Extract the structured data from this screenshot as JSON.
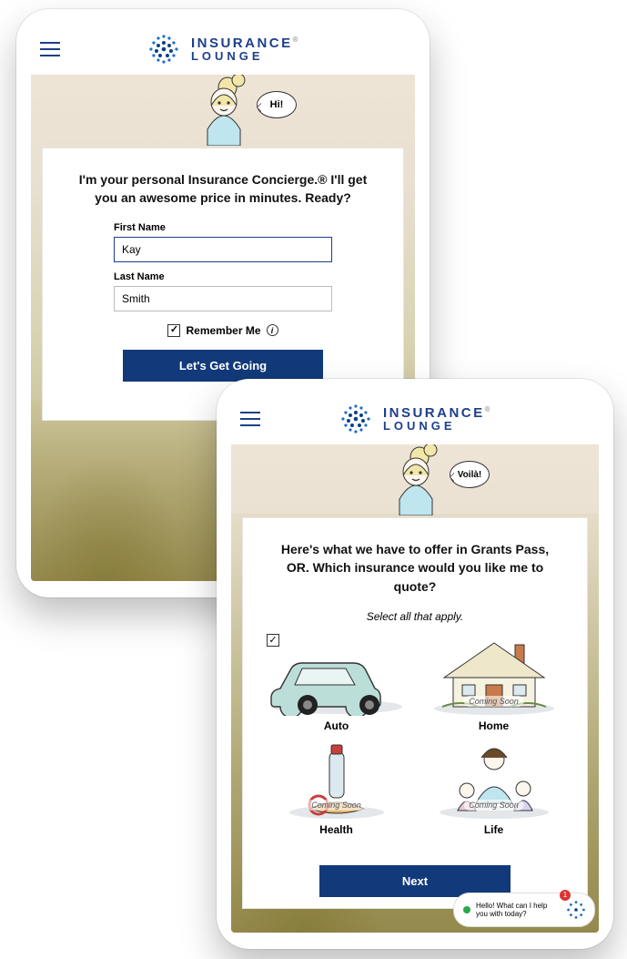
{
  "brand": {
    "line1": "INSURANCE",
    "line2": "LOUNGE",
    "reg": "®"
  },
  "back": {
    "bubble": "Hi!",
    "heading": "I'm your personal Insurance Concierge.® I'll get you an awesome price in minutes. Ready?",
    "first_label": "First Name",
    "first_value": "Kay",
    "last_label": "Last Name",
    "last_value": "Smith",
    "remember": "Remember Me",
    "cta": "Let's Get Going"
  },
  "front": {
    "bubble": "Voilà!",
    "heading": "Here's what we have to offer in Grants Pass, OR. Which insurance would you like me to quote?",
    "subnote": "Select all that apply.",
    "options": [
      {
        "label": "Auto",
        "soon": "",
        "selected": true
      },
      {
        "label": "Home",
        "soon": "Coming Soon",
        "selected": false
      },
      {
        "label": "Health",
        "soon": "Coming Soon",
        "selected": false
      },
      {
        "label": "Life",
        "soon": "Coming Soon",
        "selected": false
      }
    ],
    "cta": "Next",
    "chat": {
      "text": "Hello! What can I help you with today?",
      "badge": "1"
    }
  }
}
